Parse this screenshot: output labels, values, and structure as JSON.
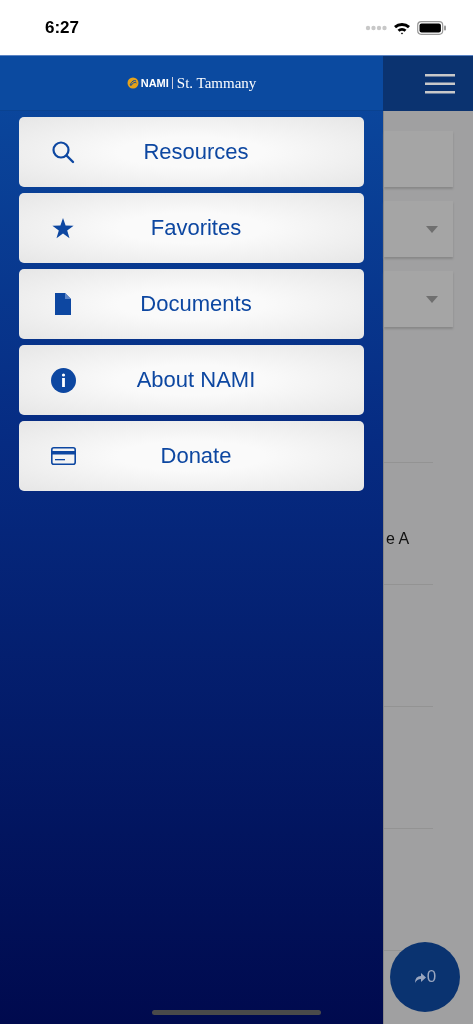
{
  "status_bar": {
    "time": "6:27"
  },
  "drawer": {
    "logo": {
      "mark": "NAMI",
      "name": "St. Tammany"
    },
    "items": [
      {
        "label": "Resources",
        "kind": "search"
      },
      {
        "label": "Favorites",
        "kind": "favorite"
      },
      {
        "label": "Documents",
        "kind": "document"
      },
      {
        "label": "About NAMI",
        "kind": "about"
      },
      {
        "label": "Donate",
        "kind": "donate"
      }
    ]
  },
  "background": {
    "fields": [
      {
        "kind": "text"
      },
      {
        "kind": "dropdown"
      },
      {
        "kind": "dropdown"
      }
    ],
    "text_fragment": "e A"
  },
  "share_button": {
    "count": "0"
  }
}
